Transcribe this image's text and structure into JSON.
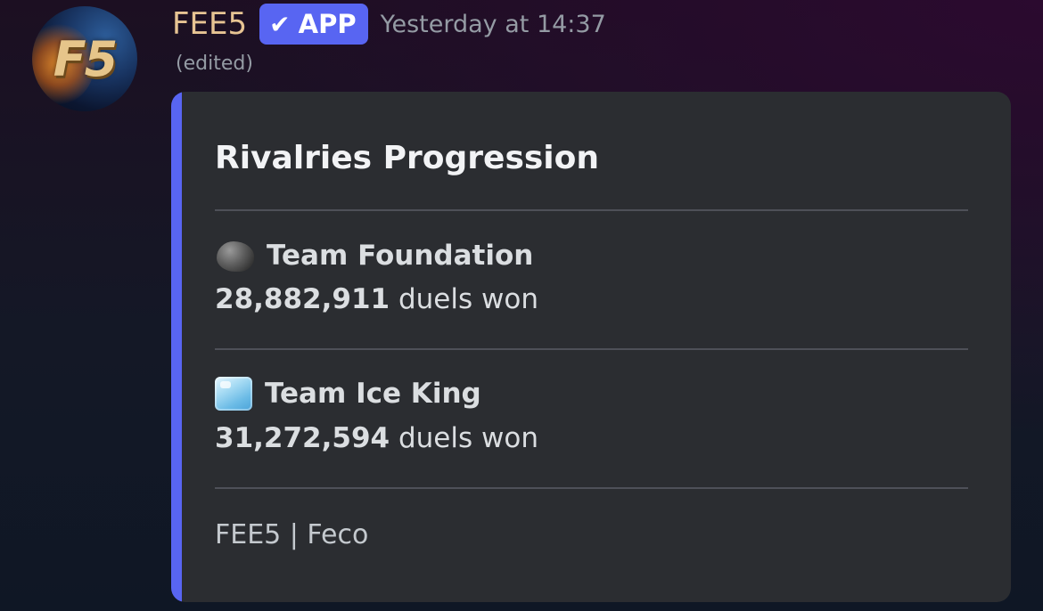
{
  "message": {
    "author": {
      "name": "FEE5",
      "avatar_text": "F5",
      "name_color": "#e7c493"
    },
    "badge": {
      "check_icon": "✔",
      "label": "APP",
      "color": "#5865f2"
    },
    "timestamp": "Yesterday at 14:37",
    "edited_label": "(edited)"
  },
  "embed": {
    "accent_color": "#5865f2",
    "title": "Rivalries Progression",
    "fields": [
      {
        "icon": "rock-icon",
        "name": "Team Foundation",
        "value_number": "28,882,911",
        "value_suffix": " duels won"
      },
      {
        "icon": "ice-cube-icon",
        "name": "Team Ice King",
        "value_number": "31,272,594",
        "value_suffix": " duels won"
      }
    ],
    "footer": "FEE5 | Feco"
  }
}
